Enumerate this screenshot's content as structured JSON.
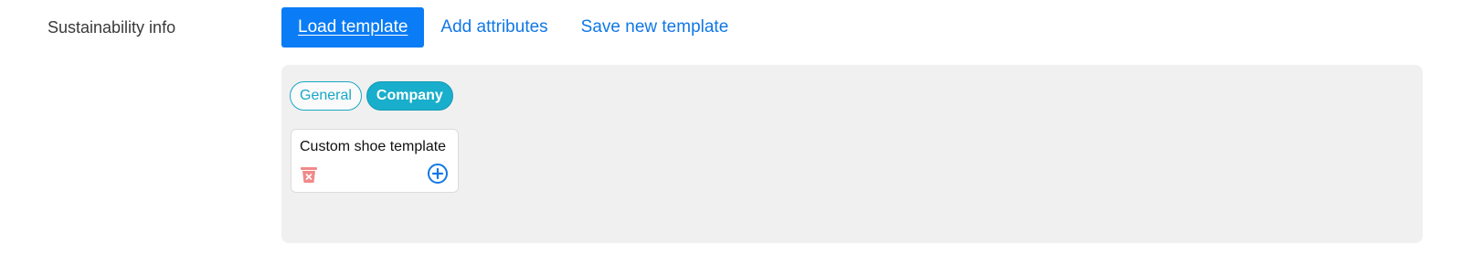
{
  "section": {
    "label": "Sustainability info"
  },
  "actions": {
    "load_template": "Load template",
    "add_attributes": "Add attributes",
    "save_new_template": "Save new template"
  },
  "tabs": [
    {
      "label": "General",
      "active": false
    },
    {
      "label": "Company",
      "active": true
    }
  ],
  "templates": [
    {
      "name": "Custom shoe template",
      "delete_icon": "trash-x-icon",
      "add_icon": "plus-circle-icon"
    }
  ],
  "colors": {
    "primary": "#0a7cf5",
    "link": "#1078e6",
    "tab_accent": "#19aecb",
    "delete_icon": "#f08a8a",
    "panel_bg": "#f0f0f0"
  }
}
